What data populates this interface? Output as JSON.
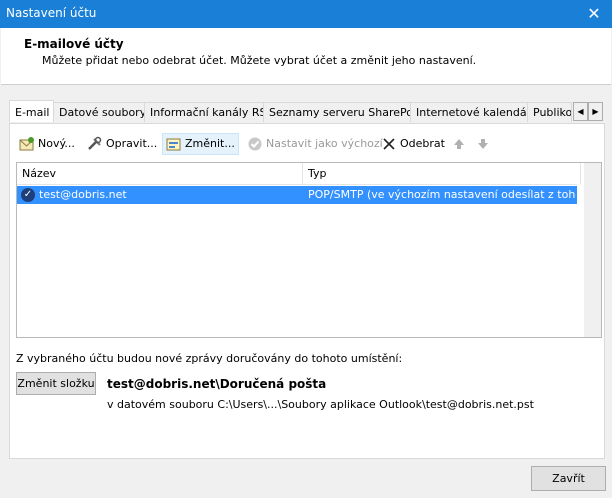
{
  "window": {
    "title": "Nastavení účtu",
    "close_glyph": "✕"
  },
  "header": {
    "title": "E-mailové účty",
    "subtitle": "Můžete přidat nebo odebrat účet. Můžete vybrat účet a změnit jeho nastavení."
  },
  "tabs": [
    {
      "label": "E-mail",
      "active": true
    },
    {
      "label": "Datové soubory"
    },
    {
      "label": "Informační kanály RSS"
    },
    {
      "label": "Seznamy serveru SharePoint"
    },
    {
      "label": "Internetové kalendáře"
    },
    {
      "label": "Publiko"
    }
  ],
  "toolbar": {
    "new": "Nový...",
    "repair": "Opravit...",
    "change": "Změnit...",
    "set_default": "Nastavit jako výchozí",
    "remove": "Odebrat"
  },
  "accounts": {
    "columns": [
      "Název",
      "Typ"
    ],
    "rows": [
      {
        "name": "test@dobris.net",
        "type": "POP/SMTP (ve výchozím nastavení odesílat z tohoto ..."
      }
    ]
  },
  "delivery": {
    "label": "Z vybraného účtu budou nové zprávy doručovány do tohoto umístění:",
    "change_folder": "Změnit složku",
    "folder": "test@dobris.net\\Doručená pošta",
    "path": "v datovém souboru C:\\Users\\...\\Soubory aplikace Outlook\\test@dobris.net.pst"
  },
  "footer": {
    "close": "Zavřít"
  },
  "colors": {
    "titlebar": "#1a7fd6",
    "selection": "#3390ff"
  }
}
